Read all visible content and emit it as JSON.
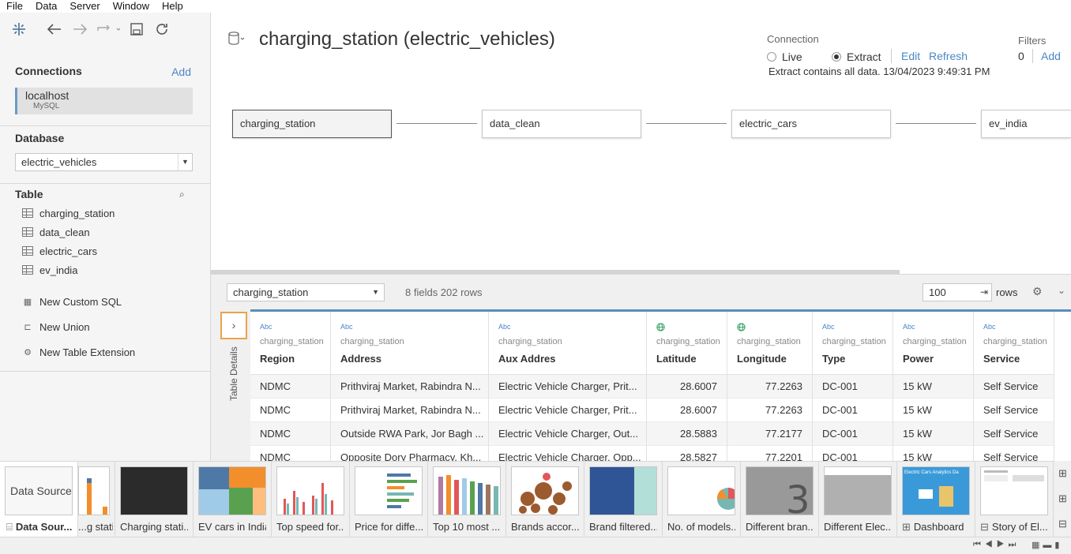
{
  "menu": [
    "File",
    "Data",
    "Server",
    "Window",
    "Help"
  ],
  "connections": {
    "title": "Connections",
    "add_label": "Add",
    "item": {
      "name": "localhost",
      "type": "MySQL"
    }
  },
  "database": {
    "title": "Database",
    "selected": "electric_vehicles"
  },
  "tables": {
    "title": "Table",
    "items": [
      "charging_station",
      "data_clean",
      "electric_cars",
      "ev_india"
    ]
  },
  "actions": [
    "New Custom SQL",
    "New Union",
    "New Table Extension"
  ],
  "header": {
    "title": "charging_station (electric_vehicles)",
    "connection_label": "Connection",
    "live_label": "Live",
    "extract_label": "Extract",
    "edit_label": "Edit",
    "refresh_label": "Refresh",
    "extract_info": "Extract contains all data. 13/04/2023 9:49:31 PM",
    "filters_label": "Filters",
    "filters_count": "0",
    "filters_add": "Add"
  },
  "canvas": {
    "tables": [
      "charging_station",
      "data_clean",
      "electric_cars",
      "ev_india"
    ]
  },
  "grid_toolbar": {
    "table_selected": "charging_station",
    "fields_info": "8 fields 202 rows",
    "rows_value": "100",
    "rows_label": "rows",
    "details_label": "Table Details"
  },
  "grid": {
    "columns": [
      {
        "type": "Abc",
        "source": "charging_station",
        "name": "Region"
      },
      {
        "type": "Abc",
        "source": "charging_station",
        "name": "Address"
      },
      {
        "type": "Abc",
        "source": "charging_station",
        "name": "Aux Addres"
      },
      {
        "type": "geo",
        "source": "charging_station",
        "name": "Latitude"
      },
      {
        "type": "geo",
        "source": "charging_station",
        "name": "Longitude"
      },
      {
        "type": "Abc",
        "source": "charging_station",
        "name": "Type"
      },
      {
        "type": "Abc",
        "source": "charging_station",
        "name": "Power"
      },
      {
        "type": "Abc",
        "source": "charging_station",
        "name": "Service"
      }
    ],
    "rows": [
      [
        "NDMC",
        "Prithviraj Market, Rabindra N...",
        "Electric Vehicle Charger, Prit...",
        "28.6007",
        "77.2263",
        "DC-001",
        "15 kW",
        "Self Service"
      ],
      [
        "NDMC",
        "Prithviraj Market, Rabindra N...",
        "Electric Vehicle Charger, Prit...",
        "28.6007",
        "77.2263",
        "DC-001",
        "15 kW",
        "Self Service"
      ],
      [
        "NDMC",
        "Outside RWA Park, Jor Bagh ...",
        "Electric Vehicle Charger, Out...",
        "28.5883",
        "77.2177",
        "DC-001",
        "15 kW",
        "Self Service"
      ],
      [
        "NDMC",
        "Opposite Dory Pharmacy, Kh...",
        "Electric Vehicle Charger, Opp...",
        "28.5827",
        "77.2201",
        "DC-001",
        "15 kW",
        "Self Service"
      ]
    ]
  },
  "tabs": [
    {
      "label": "Data Source",
      "thumb": "Data Source"
    },
    {
      "label": "...g stati..."
    },
    {
      "label": "Charging stati..."
    },
    {
      "label": "EV cars in India"
    },
    {
      "label": "Top speed for..."
    },
    {
      "label": "Price for diffe..."
    },
    {
      "label": "Top 10 most ..."
    },
    {
      "label": "Brands accor..."
    },
    {
      "label": "Brand filtered..."
    },
    {
      "label": "No. of models..."
    },
    {
      "label": "Different bran..."
    },
    {
      "label": "Different Elec..."
    },
    {
      "label": "Dashboard"
    },
    {
      "label": "Story of El..."
    }
  ],
  "active_tab_label": "Data Sour...",
  "dashboard_thumb_title": "Electric Cars Analytics Da",
  "accent_color": "#4a86c5"
}
